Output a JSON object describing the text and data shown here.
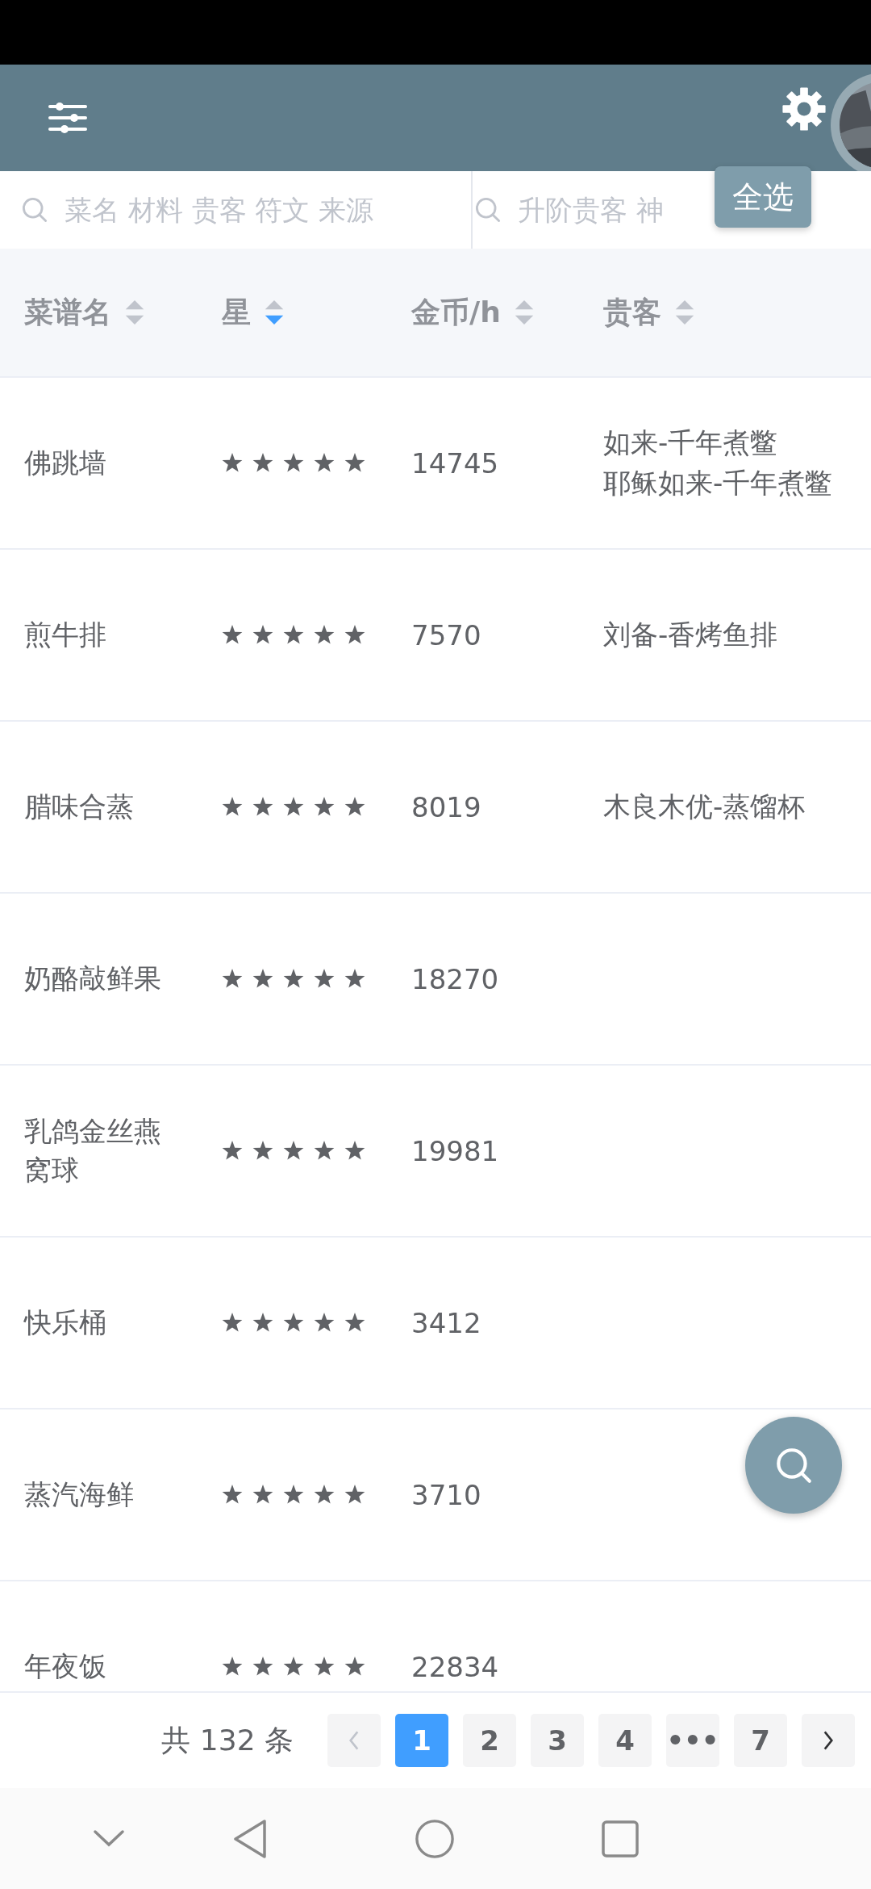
{
  "toolbar": {
    "select_all_tooltip": "全选"
  },
  "search": [
    {
      "placeholder": "菜名 材料 贵客 符文 来源"
    },
    {
      "placeholder": "升阶贵客 神"
    }
  ],
  "table": {
    "columns": [
      {
        "label": "菜谱名",
        "sorted_descending": false
      },
      {
        "label": "星",
        "sorted_descending": true
      },
      {
        "label": "金币/h",
        "sorted_descending": false
      },
      {
        "label": "贵客",
        "sorted_descending": false
      }
    ],
    "rows": [
      {
        "name": "佛跳墙",
        "stars": 5,
        "gold": "14745",
        "guests": [
          "如来-千年煮鳖",
          "耶稣如来-千年煮鳖"
        ]
      },
      {
        "name": "煎牛排",
        "stars": 5,
        "gold": "7570",
        "guests": [
          "刘备-香烤鱼排"
        ]
      },
      {
        "name": "腊味合蒸",
        "stars": 5,
        "gold": "8019",
        "guests": [
          "木良木优-蒸馏杯"
        ]
      },
      {
        "name": "奶酪敲鲜果",
        "stars": 5,
        "gold": "18270",
        "guests": []
      },
      {
        "name": "乳鸽金丝燕窝球",
        "stars": 5,
        "gold": "19981",
        "guests": []
      },
      {
        "name": "快乐桶",
        "stars": 5,
        "gold": "3412",
        "guests": []
      },
      {
        "name": "蒸汽海鲜",
        "stars": 5,
        "gold": "3710",
        "guests": []
      },
      {
        "name": "年夜饭",
        "stars": 5,
        "gold": "22834",
        "guests": []
      }
    ]
  },
  "pagination": {
    "total": "共 132 条",
    "prev_disabled": true,
    "next_disabled": false,
    "pages": [
      {
        "label": "1",
        "selected": true
      },
      {
        "label": "2",
        "selected": false
      },
      {
        "label": "3",
        "selected": false
      },
      {
        "label": "4",
        "selected": false
      },
      {
        "label": "•••",
        "selected": false
      },
      {
        "label": "7",
        "selected": false
      }
    ]
  }
}
